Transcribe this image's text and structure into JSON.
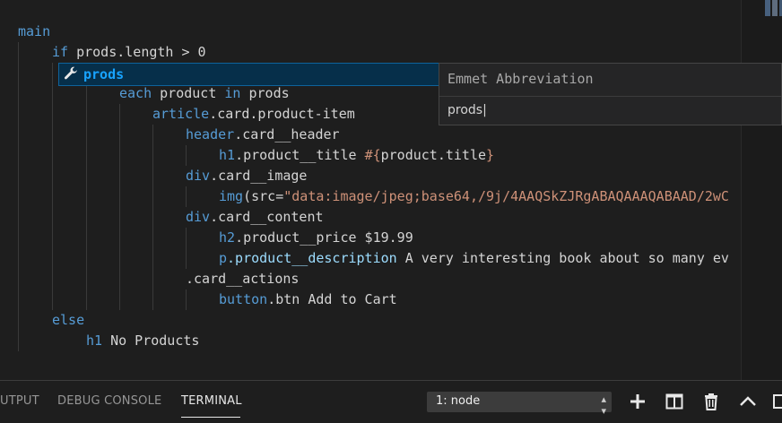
{
  "editor": {
    "lines": [
      {
        "parts": [
          {
            "t": "main",
            "c": "tag"
          }
        ]
      },
      {
        "parts": [
          {
            "t": "if",
            "c": "kw"
          },
          {
            "t": " prods.length > 0",
            "c": "plain"
          }
        ]
      },
      {
        "parts": [
          {
            "t": "prods",
            "c": "plain"
          }
        ]
      },
      {
        "parts": [
          {
            "t": "each",
            "c": "kw"
          },
          {
            "t": " product ",
            "c": "plain"
          },
          {
            "t": "in",
            "c": "kw"
          },
          {
            "t": " prods",
            "c": "plain"
          }
        ]
      },
      {
        "parts": [
          {
            "t": "article",
            "c": "tag"
          },
          {
            "t": ".card.product-item",
            "c": "plain"
          }
        ]
      },
      {
        "parts": [
          {
            "t": "header",
            "c": "tag"
          },
          {
            "t": ".card__header",
            "c": "plain"
          }
        ]
      },
      {
        "parts": [
          {
            "t": "h1",
            "c": "tag"
          },
          {
            "t": ".product__title ",
            "c": "plain"
          },
          {
            "t": "#{",
            "c": "str"
          },
          {
            "t": "product.title",
            "c": "plain"
          },
          {
            "t": "}",
            "c": "str"
          }
        ]
      },
      {
        "parts": [
          {
            "t": "div",
            "c": "tag"
          },
          {
            "t": ".card__image",
            "c": "plain"
          }
        ]
      },
      {
        "parts": [
          {
            "t": "img",
            "c": "tag"
          },
          {
            "t": "(src=",
            "c": "plain"
          },
          {
            "t": "\"data:image/jpeg;base64,/9j/4AAQSkZJRgABAQAAAQABAAD/2wC",
            "c": "str"
          }
        ]
      },
      {
        "parts": [
          {
            "t": "div",
            "c": "tag"
          },
          {
            "t": ".card__content",
            "c": "plain"
          }
        ]
      },
      {
        "parts": [
          {
            "t": "h2",
            "c": "tag"
          },
          {
            "t": ".product__price $19.99",
            "c": "plain"
          }
        ]
      },
      {
        "parts": [
          {
            "t": "p",
            "c": "tag"
          },
          {
            "t": ".product__description",
            "c": "prop"
          },
          {
            "t": " A very interesting book about so many ev",
            "c": "plain"
          }
        ]
      },
      {
        "parts": [
          {
            "t": ".card__actions",
            "c": "plain"
          }
        ]
      },
      {
        "parts": [
          {
            "t": "button",
            "c": "tag"
          },
          {
            "t": ".btn Add to Cart",
            "c": "plain"
          }
        ]
      },
      {
        "parts": [
          {
            "t": "else",
            "c": "kw"
          }
        ]
      },
      {
        "parts": [
          {
            "t": "h1",
            "c": "tag"
          },
          {
            "t": " No Products",
            "c": "plain"
          }
        ]
      }
    ]
  },
  "suggest": {
    "label": "prods",
    "icon": "wrench-icon",
    "details_title": "Emmet Abbreviation",
    "details_body": "prods|"
  },
  "panel": {
    "tabs": [
      {
        "label": "UTPUT",
        "active": false
      },
      {
        "label": "DEBUG CONSOLE",
        "active": false
      },
      {
        "label": "TERMINAL",
        "active": true
      }
    ],
    "terminal_select": "1: node",
    "buttons": [
      "plus-icon",
      "split-icon",
      "trash-icon",
      "chevron-up-icon",
      "maximize-icon"
    ]
  },
  "colors": {
    "background": "#1e1e1e",
    "keyword": "#569cd6",
    "string": "#ce9178",
    "suggest_highlight": "#18a3ff"
  }
}
